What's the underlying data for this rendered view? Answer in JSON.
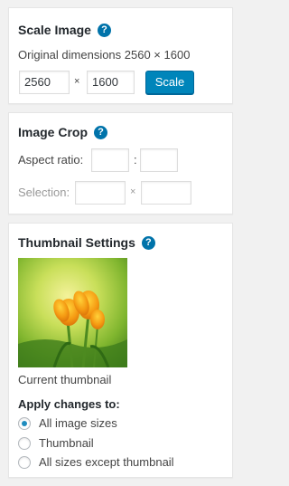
{
  "scale": {
    "title": "Scale Image",
    "help": "?",
    "original_label": "Original dimensions 2560 × 1600",
    "width_value": "2560",
    "height_value": "1600",
    "times": "×",
    "button": "Scale"
  },
  "crop": {
    "title": "Image Crop",
    "help": "?",
    "aspect_label": "Aspect ratio:",
    "aspect_sep": ":",
    "selection_label": "Selection:",
    "selection_sep": "×"
  },
  "thumb": {
    "title": "Thumbnail Settings",
    "help": "?",
    "caption": "Current thumbnail",
    "apply_label": "Apply changes to:",
    "options": [
      "All image sizes",
      "Thumbnail",
      "All sizes except thumbnail"
    ],
    "selected_option": "All image sizes"
  },
  "colors": {
    "accent": "#0073aa",
    "button": "#0085ba"
  }
}
